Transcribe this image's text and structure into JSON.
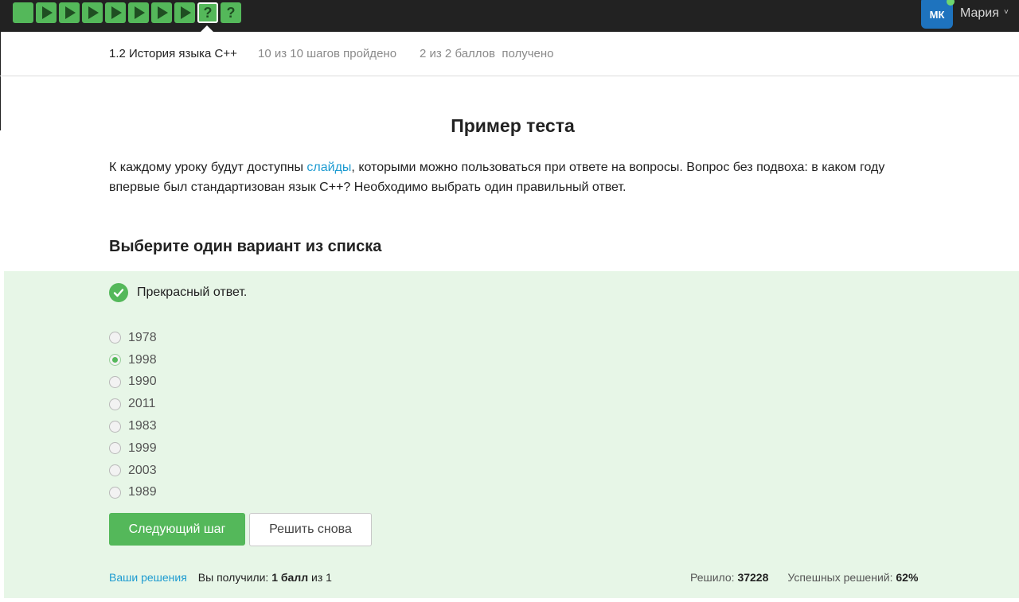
{
  "topbar": {
    "steps": [
      {
        "icon": "square-step-icon"
      },
      {
        "icon": "play-step-icon"
      },
      {
        "icon": "play-step-icon"
      },
      {
        "icon": "play-step-icon"
      },
      {
        "icon": "play-step-icon"
      },
      {
        "icon": "play-step-icon"
      },
      {
        "icon": "play-step-icon"
      },
      {
        "icon": "play-step-icon"
      },
      {
        "icon": "question-step-icon",
        "label": "?"
      },
      {
        "icon": "question-step-icon",
        "label": "?"
      }
    ],
    "user": {
      "initials": "МК",
      "name": "Мария",
      "caret": "˅"
    }
  },
  "lesson": {
    "title": "1.2 История языка C++",
    "steps_progress": "10 из 10 шагов пройдено",
    "score_progress": "2 из 2 баллов  получено"
  },
  "step": {
    "title": "Пример теста",
    "desc_before": "К каждому уроку будут доступны ",
    "desc_link": "слайды",
    "desc_after": ", которыми можно пользоваться при ответе на вопросы. Вопрос без подвоха: в каком году впервые был стандартизован язык C++? Необходимо выбрать один правильный ответ.",
    "subtitle": "Выберите один вариант из списка"
  },
  "quiz": {
    "feedback": "Прекрасный ответ.",
    "options": [
      "1978",
      "1998",
      "1990",
      "2011",
      "1983",
      "1999",
      "2003",
      "1989"
    ],
    "selected_index": 1,
    "next_button": "Следующий шаг",
    "retry_button": "Решить снова",
    "solutions_link": "Ваши решения",
    "received_label": "Вы получили: ",
    "received_value": "1 балл",
    "received_suffix": " из 1",
    "solved_label": "Решило: ",
    "solved_value": "37228",
    "success_label": "Успешных решений: ",
    "success_value": "62%"
  },
  "colors": {
    "accent": "#54b85a",
    "link": "#1d9bd1",
    "quiz_bg": "#e7f6e7",
    "topbar": "#222222",
    "avatar": "#1e73be"
  }
}
